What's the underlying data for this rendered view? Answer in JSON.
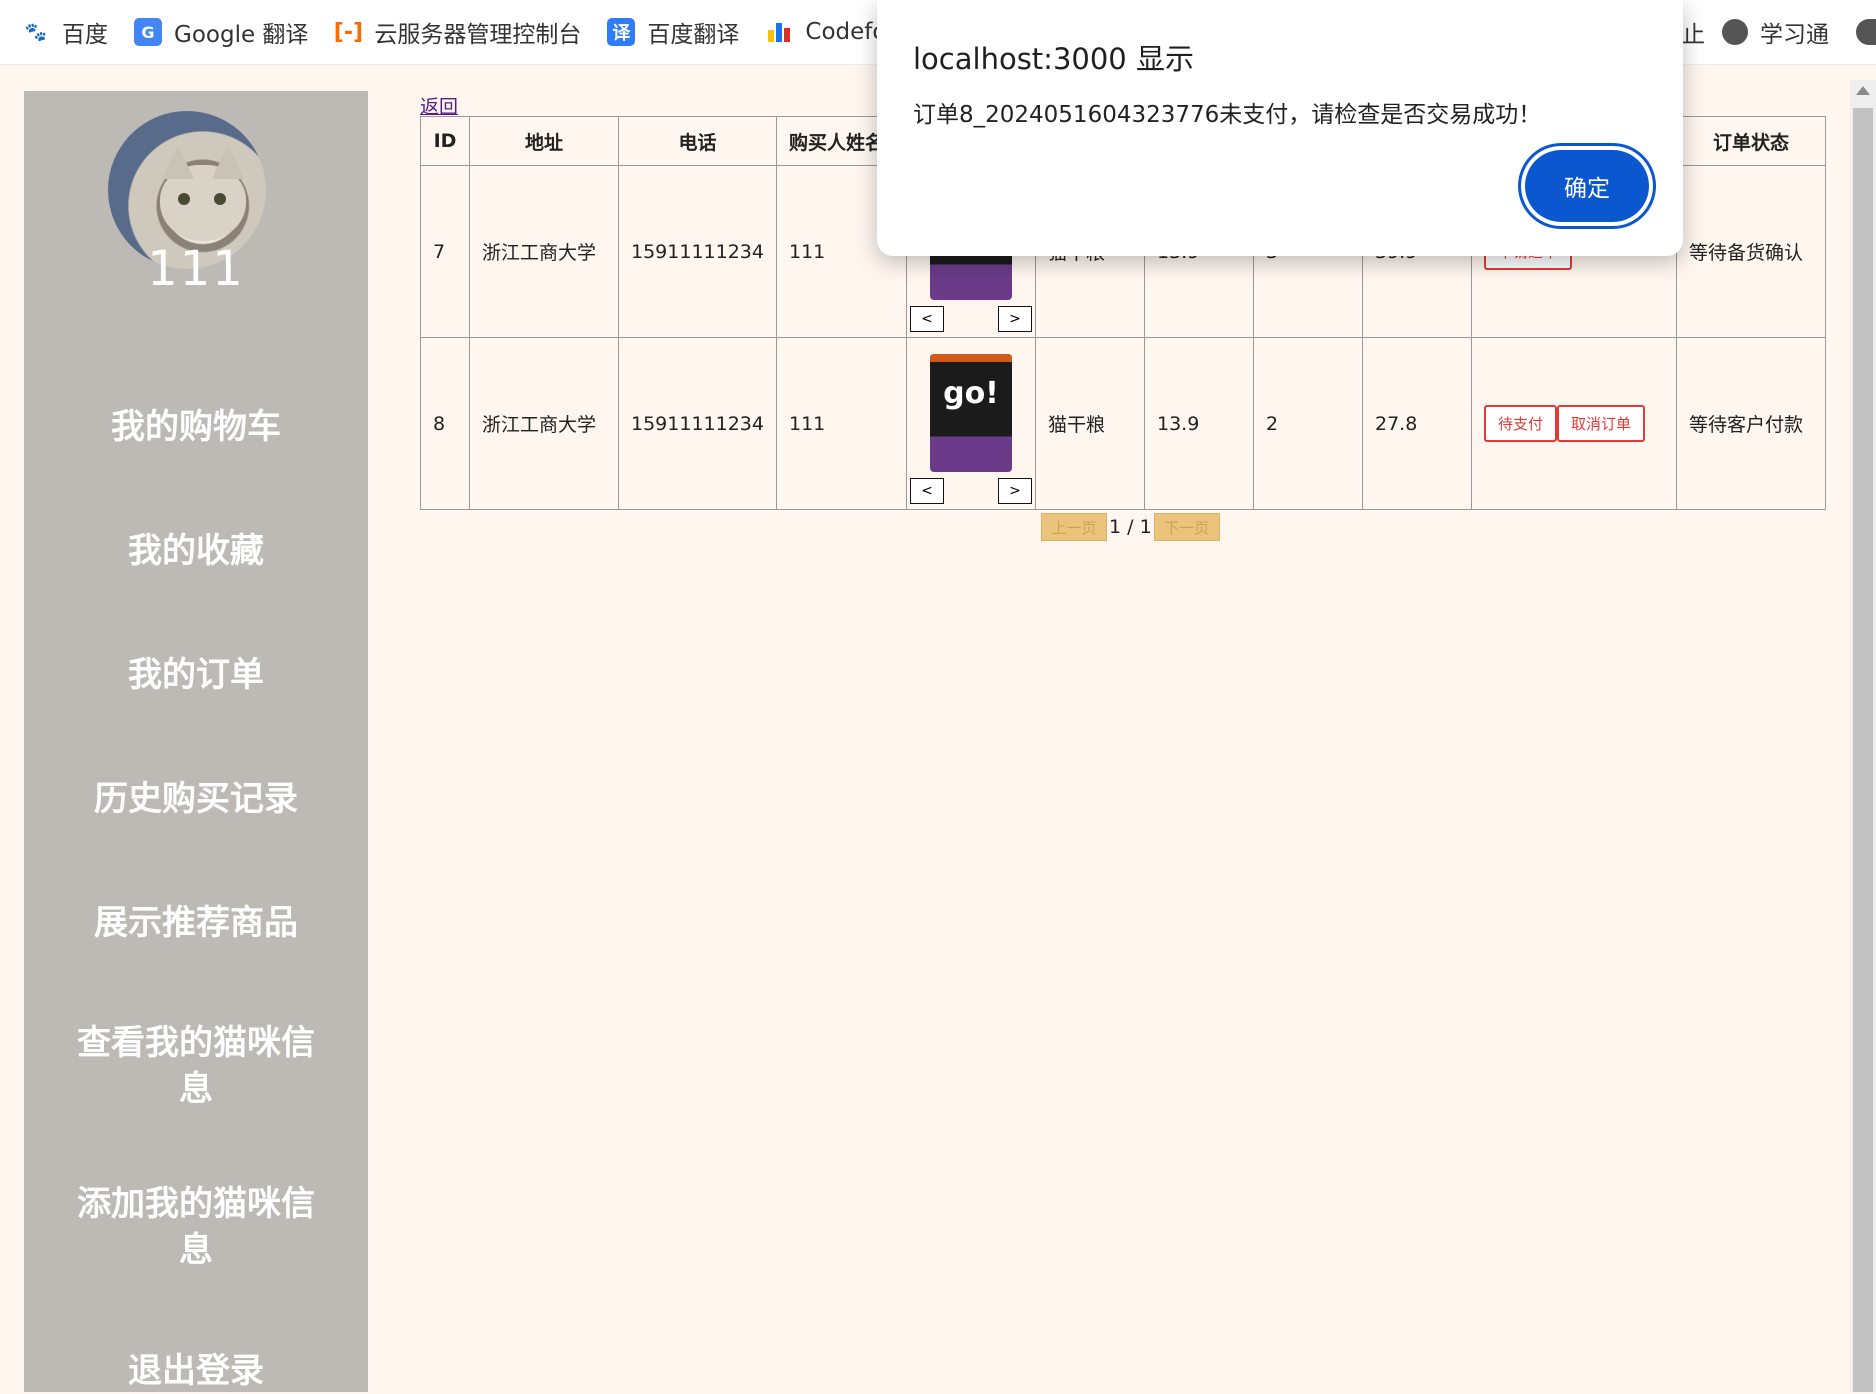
{
  "bookmarks": [
    {
      "label": "百度",
      "icon": "baidu-paw-icon"
    },
    {
      "label": "Google 翻译",
      "icon": "google-translate-icon"
    },
    {
      "label": "云服务器管理控制台",
      "icon": "aliyun-icon"
    },
    {
      "label": "百度翻译",
      "icon": "baidu-translate-icon",
      "glyph": "译"
    },
    {
      "label": "Codeforc",
      "icon": "codeforces-icon"
    }
  ],
  "bookmarks_right": {
    "partial": "止",
    "xuexitong": "学习通"
  },
  "colors": {
    "sidebar_bg": "#bdb9b4",
    "page_bg": "#fef6ef",
    "dialog_button": "#0b57d0",
    "action_red": "#e53935",
    "pager_bg": "#e9c47a"
  },
  "user": {
    "name": "111"
  },
  "nav": [
    "我的购物车",
    "我的收藏",
    "我的订单",
    "历史购买记录",
    "展示推荐商品",
    "查看我的猫咪信息",
    "添加我的猫咪信息",
    "退出登录"
  ],
  "back_label": "返回",
  "table": {
    "headers": {
      "id": "ID",
      "address": "地址",
      "phone": "电话",
      "buyer": "购买人姓名",
      "status": "订单状态"
    },
    "rows": [
      {
        "id": "7",
        "address": "浙江工商大学",
        "phone": "15911111234",
        "buyer": "111",
        "product": "猫干粮",
        "price": "13.9",
        "qty": "3",
        "total": "39.9",
        "action": "申请退单",
        "status": "等待备货确认"
      },
      {
        "id": "8",
        "address": "浙江工商大学",
        "phone": "15911111234",
        "buyer": "111",
        "product": "猫干粮",
        "price": "13.9",
        "qty": "2",
        "total": "27.8",
        "action_pay": "待支付",
        "action_cancel": "取消订单",
        "status": "等待客户付款"
      }
    ],
    "img_prev": "<",
    "img_next": ">",
    "pouch_text": "go!"
  },
  "pager": {
    "prev": "上一页",
    "info": "1 / 1",
    "next": "下一页"
  },
  "dialog": {
    "title": "localhost:3000 显示",
    "message": "订单8_2024051604323776未支付，请检查是否交易成功！",
    "ok": "确定"
  }
}
